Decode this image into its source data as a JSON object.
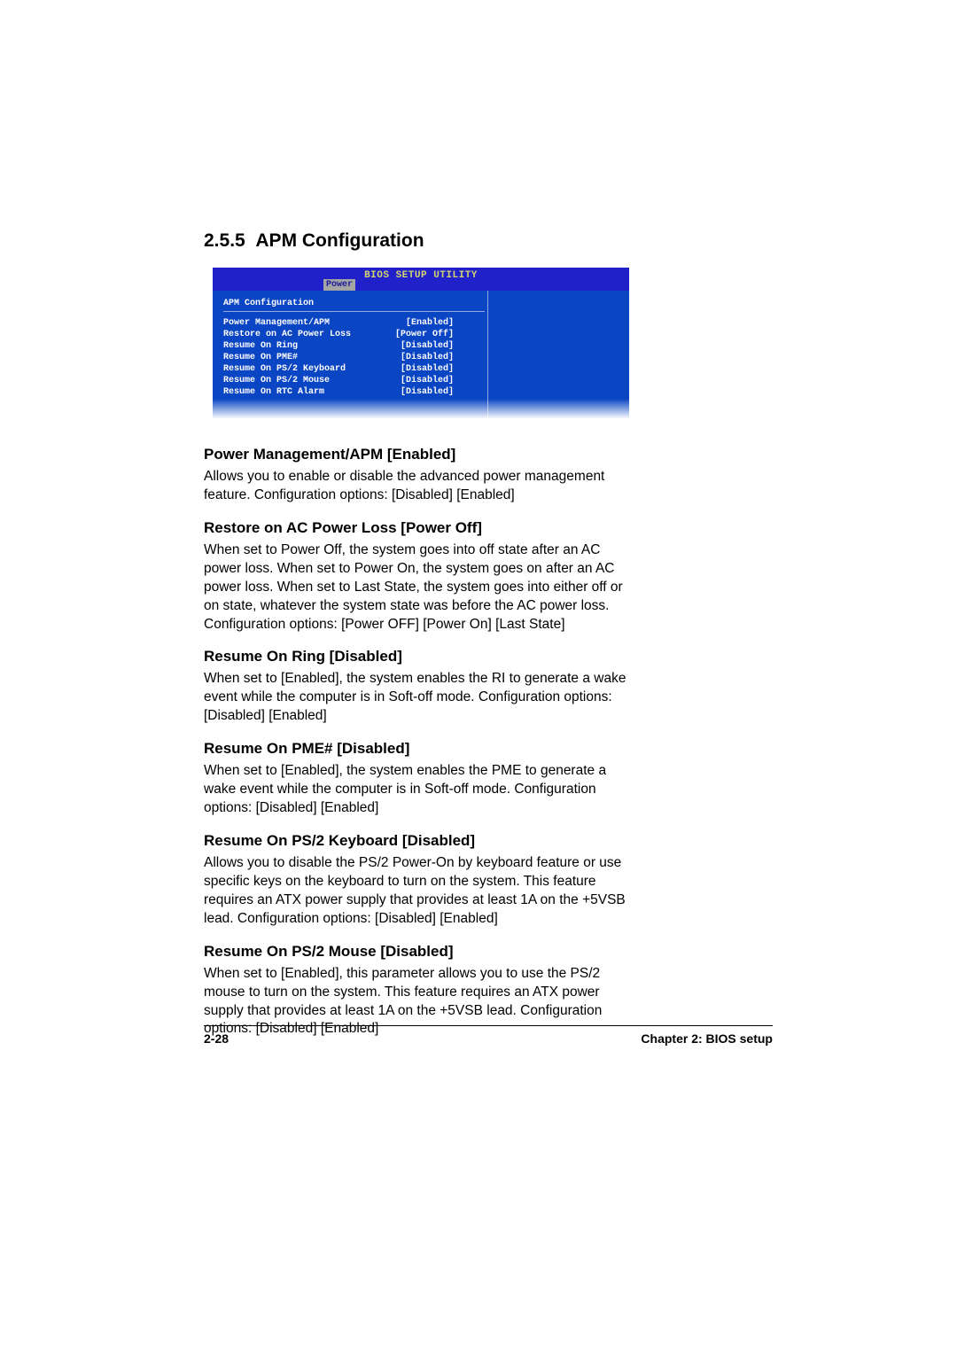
{
  "section": {
    "number": "2.5.5",
    "title": "APM Configuration"
  },
  "bios": {
    "header_title": "BIOS SETUP UTILITY",
    "tab": "Power",
    "panel_title": "APM Configuration",
    "rows": [
      {
        "label": "Power Management/APM",
        "value": "[Enabled]"
      },
      {
        "label": "Restore on AC Power Loss",
        "value": "[Power Off]"
      },
      {
        "label": "Resume On Ring",
        "value": "[Disabled]"
      },
      {
        "label": "Resume On PME#",
        "value": "[Disabled]"
      },
      {
        "label": "Resume On PS/2 Keyboard",
        "value": "[Disabled]"
      },
      {
        "label": "Resume On PS/2 Mouse",
        "value": "[Disabled]"
      },
      {
        "label": "Resume On RTC Alarm",
        "value": "[Disabled]"
      }
    ]
  },
  "descriptions": [
    {
      "heading": "Power Management/APM [Enabled]",
      "body": "Allows you to enable or disable the advanced power management feature. Configuration options: [Disabled] [Enabled]"
    },
    {
      "heading": "Restore on AC Power Loss [Power Off]",
      "body": "When set to Power Off, the system goes into off state after an AC power loss. When set to Power On, the system goes on after an AC power loss. When set to Last State, the system goes into either off or on state, whatever the system state was before the AC power loss. Configuration options: [Power OFF] [Power On] [Last State]"
    },
    {
      "heading": "Resume On Ring [Disabled]",
      "body": "When set to [Enabled], the system enables the RI to generate a wake event while the computer is in Soft-off mode. Configuration options: [Disabled] [Enabled]"
    },
    {
      "heading": "Resume On PME# [Disabled]",
      "body": "When set to [Enabled], the system enables the PME to generate a wake event while the computer is in Soft-off mode. Configuration options: [Disabled] [Enabled]"
    },
    {
      "heading": "Resume On PS/2 Keyboard [Disabled]",
      "body": "Allows you to disable the PS/2 Power-On by keyboard feature or use specific keys on the keyboard to turn on the system. This feature requires an ATX power supply that provides at least 1A on the +5VSB lead. Configuration options: [Disabled] [Enabled]"
    },
    {
      "heading": "Resume On PS/2 Mouse [Disabled]",
      "body": "When set to [Enabled], this parameter allows you to use the PS/2 mouse to turn on the system. This feature requires an ATX power supply that provides at least 1A on the +5VSB lead. Configuration options: [Disabled] [Enabled]"
    }
  ],
  "footer": {
    "page": "2-28",
    "chapter": "Chapter 2: BIOS setup"
  }
}
